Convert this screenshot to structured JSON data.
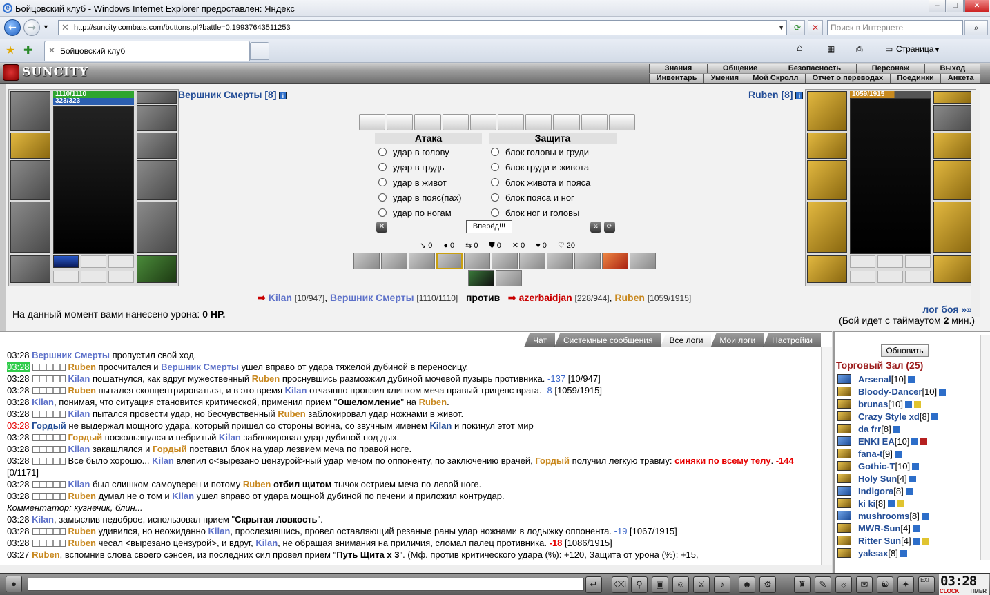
{
  "window": {
    "title": "Бойцовский клуб - Windows Internet Explorer предоставлен: Яндекс"
  },
  "browser": {
    "url": "http://suncity.combats.com/buttons.pl?battle=0.19937643511253",
    "search_placeholder": "Поиск в Интернете",
    "tab_title": "Бойцовский клуб",
    "page_menu": "Страница"
  },
  "game": {
    "logo": "SUNCITY",
    "menu_top": [
      "Знания",
      "Общение",
      "Безопасность",
      "Персонаж",
      "Выход"
    ],
    "menu_bottom": [
      "Инвентарь",
      "Умения",
      "Мой Скролл",
      "Отчет о переводах",
      "Поединки",
      "Анкета"
    ]
  },
  "player": {
    "name": "Вершник Смерты [8]",
    "hp": "1110/1110",
    "mp": "323/323"
  },
  "enemy": {
    "name": "Ruben [8]",
    "hp": "1059/1915"
  },
  "attack": {
    "header": "Атака",
    "options": [
      "удар в голову",
      "удар в грудь",
      "удар в живот",
      "удар в пояс(пах)",
      "удар по ногам"
    ]
  },
  "defense": {
    "header": "Защита",
    "options": [
      "блок головы и груди",
      "блок груди и живота",
      "блок живота и пояса",
      "блок пояса и ног",
      "блок ног и головы"
    ]
  },
  "forward_button": "Вперёд!!!",
  "counters": [
    "0",
    "0",
    "0",
    "0",
    "0",
    "0",
    "20"
  ],
  "vs_line": {
    "team1": [
      {
        "name": "Kilan",
        "hp": "[10/947]"
      },
      {
        "name": "Вершник Смерты",
        "hp": "[1110/1110]"
      }
    ],
    "vs": "против",
    "team2": [
      {
        "name": "azerbaidjan",
        "hp": "[228/944]"
      },
      {
        "name": "Ruben",
        "hp": "[1059/1915]"
      }
    ]
  },
  "damage": {
    "label": "На данный момент вами нанесено урона:",
    "value": "0 HP."
  },
  "log_link": "лог боя »»",
  "timeout": {
    "prefix": "(Бой идет с таймаутом",
    "value": "2",
    "suffix": "мин.)"
  },
  "log_tabs": [
    "Чат",
    "Системные сообщения",
    "Все логи",
    "Мои логи",
    "Настройки"
  ],
  "log": [
    {
      "t": "03:28",
      "parts": [
        [
          "Вершник Смерты",
          "k"
        ],
        [
          " пропустил свой ход.",
          ""
        ]
      ]
    },
    {
      "t": "03:28",
      "hl": true,
      "sq": true,
      "parts": [
        [
          "Ruben",
          "g"
        ],
        [
          " просчитался и ",
          ""
        ],
        [
          "Вершник Смерты",
          "k"
        ],
        [
          " ушел вправо от удара тяжелой дубиной в переносицу.",
          ""
        ]
      ]
    },
    {
      "t": "03:28",
      "sq": true,
      "parts": [
        [
          "Kilan",
          "k"
        ],
        [
          " пошатнулся, как вдруг мужественный ",
          ""
        ],
        [
          "Ruben",
          "g"
        ],
        [
          " проснувшись размозжил дубиной мочевой пузырь противника. ",
          ""
        ],
        [
          "-137",
          "d"
        ],
        [
          " [10/947]",
          ""
        ]
      ]
    },
    {
      "t": "03:28",
      "sq": true,
      "parts": [
        [
          "Ruben",
          "g"
        ],
        [
          " пытался сконцентрироваться, и в это время ",
          ""
        ],
        [
          "Kilan",
          "k"
        ],
        [
          " отчаянно пронзил клинком меча правый трицепс врага. ",
          ""
        ],
        [
          "-8",
          "d"
        ],
        [
          " [1059/1915]",
          ""
        ]
      ]
    },
    {
      "t": "03:28",
      "parts": [
        [
          "Kilan",
          "k"
        ],
        [
          ", понимая, что ситуация становится критической, применил прием \"",
          ""
        ],
        [
          "Ошеломление",
          "b"
        ],
        [
          "\" на ",
          ""
        ],
        [
          "Ruben",
          "g"
        ],
        [
          ".",
          ""
        ]
      ]
    },
    {
      "t": "03:28",
      "sq": true,
      "parts": [
        [
          "Kilan",
          "k"
        ],
        [
          " пытался провести удар, но бесчувственный ",
          ""
        ],
        [
          "Ruben",
          "g"
        ],
        [
          " заблокировал удар ножнами в живот.",
          ""
        ]
      ]
    },
    {
      "t": "03:28",
      "tred": true,
      "parts": [
        [
          "Гордый",
          "bk"
        ],
        [
          " не выдержал мощного удара, который пришел со стороны воина, со звучным именем ",
          ""
        ],
        [
          "Kilan",
          "bk"
        ],
        [
          " и покинул этот мир",
          ""
        ]
      ]
    },
    {
      "t": "03:28",
      "sq": true,
      "parts": [
        [
          "Гордый",
          "g"
        ],
        [
          " поскользнулся и небритый ",
          ""
        ],
        [
          "Kilan",
          "k"
        ],
        [
          " заблокировал удар дубиной под дых.",
          ""
        ]
      ]
    },
    {
      "t": "03:28",
      "sq": true,
      "parts": [
        [
          "Kilan",
          "k"
        ],
        [
          " закашлялся и ",
          ""
        ],
        [
          "Гордый",
          "g"
        ],
        [
          " поставил блок на удар лезвием меча по правой ноге.",
          ""
        ]
      ]
    },
    {
      "t": "03:28",
      "sq": true,
      "wrap": true,
      "parts": [
        [
          "Все было хорошо... ",
          ""
        ],
        [
          "Kilan",
          "k"
        ],
        [
          " влепил о<вырезано цензурой>ный удар мечом по оппоненту, по заключению врачей, ",
          ""
        ],
        [
          "Гордый",
          "g"
        ],
        [
          " получил легкую травму: ",
          ""
        ],
        [
          "синяки по всему телу",
          "r"
        ],
        [
          ". ",
          ""
        ],
        [
          "-144",
          "r"
        ],
        [
          " [0/1171]",
          ""
        ]
      ]
    },
    {
      "t": "03:28",
      "sq": true,
      "parts": [
        [
          "Kilan",
          "k"
        ],
        [
          " был слишком самоуверен и потому ",
          ""
        ],
        [
          "Ruben",
          "g"
        ],
        [
          " ",
          ""
        ],
        [
          "отбил щитом",
          "b"
        ],
        [
          " тычок острием меча по левой ноге.",
          ""
        ]
      ]
    },
    {
      "t": "03:28",
      "sq": true,
      "parts": [
        [
          "Ruben",
          "g"
        ],
        [
          " думал не о том и ",
          ""
        ],
        [
          "Kilan",
          "k"
        ],
        [
          " ушел вправо от удара мощной дубиной по печени и приложил контрудар.",
          ""
        ]
      ]
    },
    {
      "t": "",
      "parts": [
        [
          "Комментатор: кузнечик, блин...",
          "i"
        ]
      ]
    },
    {
      "t": "03:28",
      "parts": [
        [
          "Kilan",
          "k"
        ],
        [
          ", замыслив недоброе, использовал прием \"",
          ""
        ],
        [
          "Скрытая ловкость",
          "b"
        ],
        [
          "\".",
          ""
        ]
      ]
    },
    {
      "t": "03:28",
      "sq": true,
      "parts": [
        [
          "Ruben",
          "g"
        ],
        [
          " удивился, но неожиданно ",
          ""
        ],
        [
          "Kilan",
          "k"
        ],
        [
          ", прослезившись, провел оставляющий резаные раны удар ножнами в лодыжку оппонента. ",
          ""
        ],
        [
          "-19",
          "d"
        ],
        [
          " [1067/1915]",
          ""
        ]
      ]
    },
    {
      "t": "03:28",
      "sq": true,
      "parts": [
        [
          "Ruben",
          "g"
        ],
        [
          " чесал <вырезано цензурой>, и вдруг, ",
          ""
        ],
        [
          "Kilan",
          "k"
        ],
        [
          ", не обращая внимания на приличия, сломал палец противника. ",
          ""
        ],
        [
          "-18",
          "r"
        ],
        [
          " [1086/1915]",
          ""
        ]
      ]
    },
    {
      "t": "03:27",
      "parts": [
        [
          "Ruben",
          "g"
        ],
        [
          ", вспомнив слова своего сэнсея, из последних сил провел прием \"",
          ""
        ],
        [
          "Путь Щита x 3",
          "b"
        ],
        [
          "\". (Мф. против критического удара (%): +120, Защита от урона (%): +15,",
          ""
        ]
      ]
    }
  ],
  "room": {
    "refresh": "Обновить",
    "name": "Торговый Зал (25)"
  },
  "users": [
    {
      "name": "Arsenal",
      "lvl": "[10]",
      "ic": "b"
    },
    {
      "name": "Bloody-Dancer",
      "lvl": "[10]",
      "ic": "g"
    },
    {
      "name": "brunas",
      "lvl": "[10]",
      "ic": "g",
      "y": true
    },
    {
      "name": "Crazy Style xd",
      "lvl": "[8]",
      "ic": "g"
    },
    {
      "name": "da frr",
      "lvl": "[8]",
      "ic": "g"
    },
    {
      "name": "ENKI EA",
      "lvl": "[10]",
      "ic": "b",
      "r": true
    },
    {
      "name": "fana-t",
      "lvl": "[9]",
      "ic": "g"
    },
    {
      "name": "Gothic-T",
      "lvl": "[10]",
      "ic": "g"
    },
    {
      "name": "Holy Sun",
      "lvl": "[4]",
      "ic": "g"
    },
    {
      "name": "Indigora",
      "lvl": "[8]",
      "ic": "b"
    },
    {
      "name": "ki ki",
      "lvl": "[8]",
      "ic": "g",
      "y": true
    },
    {
      "name": "mushrooms",
      "lvl": "[8]",
      "ic": "b"
    },
    {
      "name": "MWR-Sun",
      "lvl": "[4]",
      "ic": "g"
    },
    {
      "name": "Ritter Sun",
      "lvl": "[4]",
      "ic": "g",
      "y": true
    },
    {
      "name": "yaksax",
      "lvl": "[8]",
      "ic": "g"
    }
  ],
  "clock": {
    "time": "03:28",
    "label1": "CLOCK",
    "label2": "TIMER",
    "exit": "EXIT"
  }
}
